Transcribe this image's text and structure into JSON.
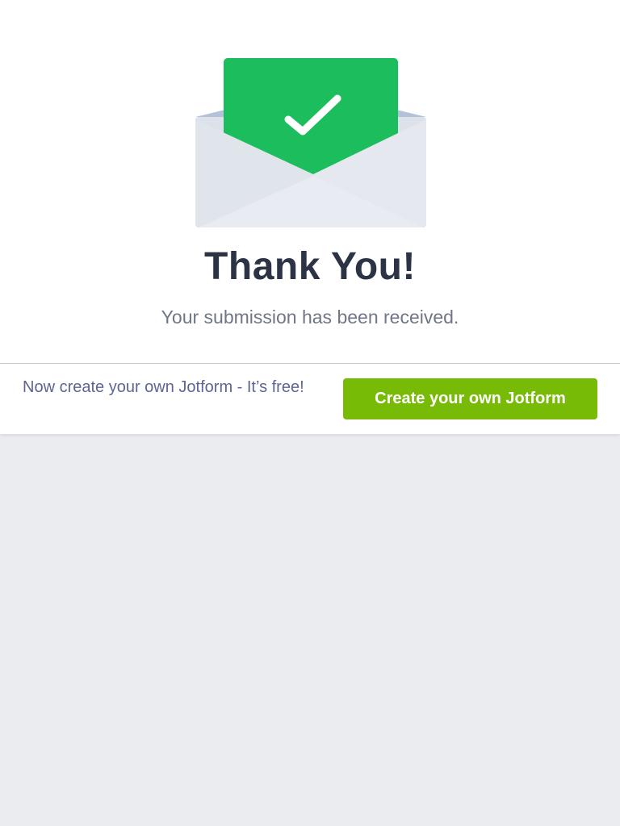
{
  "confirmation": {
    "icon": "envelope-check-icon",
    "title": "Thank You!",
    "message": "Your submission has been received."
  },
  "promo": {
    "text": "Now create your own Jotform - It’s free!",
    "button_label": "Create your own Jotform"
  },
  "colors": {
    "check_green": "#1bbd5d",
    "button_green": "#78bb07",
    "title": "#2c3345",
    "promo_text": "#5e6496",
    "page_background": "#ebecf0"
  }
}
